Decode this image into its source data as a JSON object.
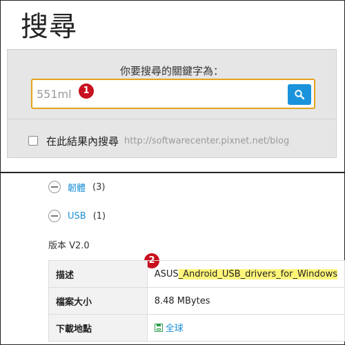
{
  "header": {
    "title": "搜尋"
  },
  "search": {
    "label": "你要搜尋的關鍵字為：",
    "value": "551ml",
    "button_icon": "magnifier-icon",
    "scope_label": "在此結果內搜尋",
    "scope_url": "http://softwarecenter.pixnet.net/blog"
  },
  "badges": {
    "one": "1",
    "two": "2"
  },
  "tags": [
    {
      "label": "韌體",
      "count": "(3)"
    },
    {
      "label": "USB",
      "count": "(1)"
    }
  ],
  "version": "版本 V2.0",
  "info_table": {
    "description": {
      "key": "描述",
      "prefix": "ASUS",
      "highlight": "_Android_USB_drivers_for_Windows"
    },
    "size": {
      "key": "檔案大小",
      "value": "8.48 MBytes"
    },
    "download": {
      "key": "下載地點",
      "value": "全球"
    }
  },
  "colors": {
    "accent": "#1a93dc",
    "border_focus": "#e3a31a",
    "badge": "#c8101e",
    "highlight": "#fff57a",
    "link": "#1a8fd6"
  }
}
